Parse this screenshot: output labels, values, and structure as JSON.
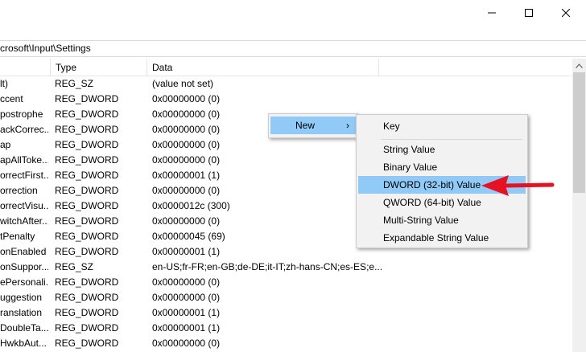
{
  "window": {
    "minimize_glyph": "—",
    "maximize_glyph": "☐",
    "close_glyph": "✕"
  },
  "address": {
    "path": "crosoft\\Input\\Settings"
  },
  "columns": {
    "name": "",
    "type": "Type",
    "data": "Data"
  },
  "rows": [
    {
      "name": "lt)",
      "type": "REG_SZ",
      "data": "(value not set)"
    },
    {
      "name": "ccent",
      "type": "REG_DWORD",
      "data": "0x00000000 (0)"
    },
    {
      "name": "postrophe",
      "type": "REG_DWORD",
      "data": "0x00000000 (0)"
    },
    {
      "name": "ackCorrec...",
      "type": "REG_DWORD",
      "data": "0x00000000 (0)"
    },
    {
      "name": "ap",
      "type": "REG_DWORD",
      "data": "0x00000000 (0)"
    },
    {
      "name": "apAllToke...",
      "type": "REG_DWORD",
      "data": "0x00000000 (0)"
    },
    {
      "name": "orrectFirst...",
      "type": "REG_DWORD",
      "data": "0x00000001 (1)"
    },
    {
      "name": "orrection",
      "type": "REG_DWORD",
      "data": "0x00000000 (0)"
    },
    {
      "name": "orrectVisu...",
      "type": "REG_DWORD",
      "data": "0x0000012c (300)"
    },
    {
      "name": "witchAfter...",
      "type": "REG_DWORD",
      "data": "0x00000000 (0)"
    },
    {
      "name": "tPenalty",
      "type": "REG_DWORD",
      "data": "0x00000045 (69)"
    },
    {
      "name": "onEnabled",
      "type": "REG_DWORD",
      "data": "0x00000001 (1)"
    },
    {
      "name": "onSuppor...",
      "type": "REG_SZ",
      "data": "en-US;fr-FR;en-GB;de-DE;it-IT;zh-hans-CN;es-ES;e..."
    },
    {
      "name": "ePersonali...",
      "type": "REG_DWORD",
      "data": "0x00000000 (0)"
    },
    {
      "name": "uggestion",
      "type": "REG_DWORD",
      "data": "0x00000000 (0)"
    },
    {
      "name": "ranslation",
      "type": "REG_DWORD",
      "data": "0x00000001 (1)"
    },
    {
      "name": "DoubleTa...",
      "type": "REG_DWORD",
      "data": "0x00000001 (1)"
    },
    {
      "name": "HwkbAut...",
      "type": "REG_DWORD",
      "data": "0x00000000 (0)"
    }
  ],
  "context_menu": {
    "new_label": "New",
    "submenu_arrow": "›"
  },
  "submenu": {
    "key": "Key",
    "string_value": "String Value",
    "binary_value": "Binary Value",
    "dword_value": "DWORD (32-bit) Value",
    "qword_value": "QWORD (64-bit) Value",
    "multi_string_value": "Multi-String Value",
    "expandable_string_value": "Expandable String Value"
  },
  "colors": {
    "highlight": "#91c9f7",
    "annotation_arrow": "#e81123",
    "menu_background": "#f2f2f2"
  }
}
